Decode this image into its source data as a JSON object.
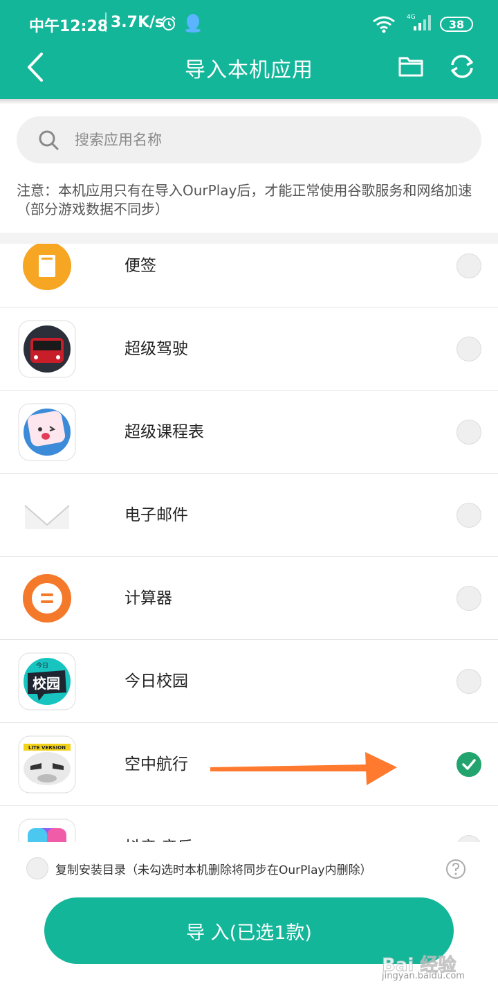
{
  "status_bar": {
    "time": "中午12:28",
    "speed": "3.7K/s",
    "network": "4G",
    "battery": "38"
  },
  "header": {
    "title": "导入本机应用"
  },
  "search": {
    "placeholder": "搜索应用名称"
  },
  "notice": "注意：本机应用只有在导入OurPlay后，才能正常使用谷歌服务和网络加速（部分游戏数据不同步）",
  "apps": [
    {
      "name": "便签",
      "selected": false
    },
    {
      "name": "超级驾驶",
      "selected": false
    },
    {
      "name": "超级课程表",
      "selected": false
    },
    {
      "name": "电子邮件",
      "selected": false
    },
    {
      "name": "计算器",
      "selected": false
    },
    {
      "name": "今日校园",
      "selected": false
    },
    {
      "name": "空中航行",
      "selected": true
    },
    {
      "name": "抖音·音乐",
      "selected": false
    }
  ],
  "app_icon_text": {
    "campus": "校园",
    "campus_tag": "今日",
    "plane_tag": "LITE VERSION"
  },
  "footer": {
    "copy_label": "复制安装目录（未勾选时本机删除将同步在OurPlay内删除）",
    "import_button": "导 入(已选1款)"
  },
  "watermark": {
    "brand": "Bai 经验",
    "url": "jingyan.baidu.com"
  },
  "colors": {
    "primary": "#14b69a",
    "checked": "#23a36d",
    "arrow": "#ff7a2e"
  }
}
